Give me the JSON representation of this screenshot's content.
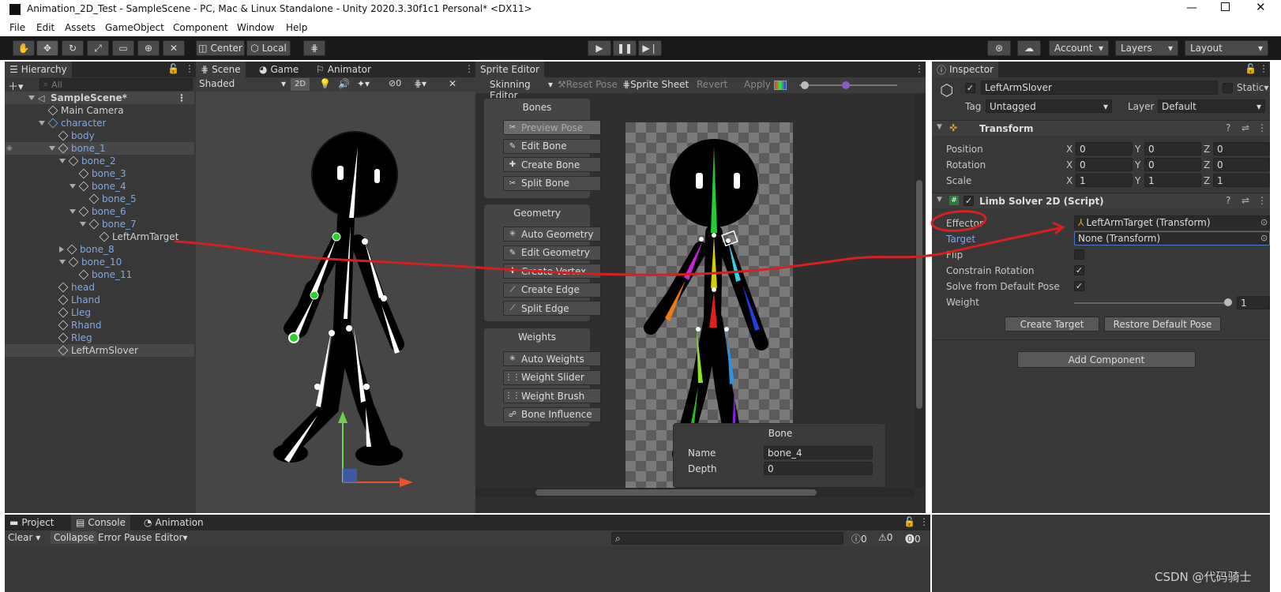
{
  "title_bar": {
    "title": "Animation_2D_Test - SampleScene - PC, Mac & Linux Standalone - Unity 2020.3.30f1c1 Personal* <DX11>"
  },
  "menu": [
    "File",
    "Edit",
    "Assets",
    "GameObject",
    "Component",
    "Window",
    "Help"
  ],
  "toolbar": {
    "center": "Center",
    "local": "Local",
    "account": "Account",
    "layers": "Layers",
    "layout": "Layout"
  },
  "hierarchy": {
    "tab": "Hierarchy",
    "search_placeholder": "All",
    "items": [
      {
        "label": "SampleScene*",
        "blue": false
      },
      {
        "label": "Main Camera",
        "blue": false
      },
      {
        "label": "character",
        "blue": true
      },
      {
        "label": "body",
        "blue": true
      },
      {
        "label": "bone_1",
        "blue": true
      },
      {
        "label": "bone_2",
        "blue": true
      },
      {
        "label": "bone_3",
        "blue": true
      },
      {
        "label": "bone_4",
        "blue": true
      },
      {
        "label": "bone_5",
        "blue": true
      },
      {
        "label": "bone_6",
        "blue": true
      },
      {
        "label": "bone_7",
        "blue": true
      },
      {
        "label": "LeftArmTarget",
        "blue": false
      },
      {
        "label": "bone_8",
        "blue": true
      },
      {
        "label": "bone_10",
        "blue": true
      },
      {
        "label": "bone_11",
        "blue": true
      },
      {
        "label": "head",
        "blue": true
      },
      {
        "label": "Lhand",
        "blue": true
      },
      {
        "label": "Lleg",
        "blue": true
      },
      {
        "label": "Rhand",
        "blue": true
      },
      {
        "label": "Rleg",
        "blue": true
      },
      {
        "label": "LeftArmSlover",
        "blue": false
      }
    ]
  },
  "scene": {
    "tabs": [
      "Scene",
      "Game",
      "Animator"
    ],
    "shading": "Shaded",
    "mode_2d": "2D",
    "hidden_count": "0"
  },
  "sprite_editor": {
    "tab": "Sprite Editor",
    "mode": "Skinning Editor",
    "reset_pose": "Reset Pose",
    "sprite_sheet": "Sprite Sheet",
    "revert": "Revert",
    "apply": "Apply",
    "bones_title": "Bones",
    "bones": [
      "Preview Pose",
      "Edit Bone",
      "Create Bone",
      "Split Bone"
    ],
    "geometry_title": "Geometry",
    "geometry": [
      "Auto Geometry",
      "Edit Geometry",
      "Create Vertex",
      "Create Edge",
      "Split Edge"
    ],
    "weights_title": "Weights",
    "weights": [
      "Auto Weights",
      "Weight Slider",
      "Weight Brush",
      "Bone Influence"
    ],
    "bone_panel": {
      "title": "Bone",
      "name_label": "Name",
      "name_value": "bone_4",
      "depth_label": "Depth",
      "depth_value": "0"
    }
  },
  "inspector": {
    "tab": "Inspector",
    "object_name": "LeftArmSlover",
    "static": "Static",
    "tag_label": "Tag",
    "tag_value": "Untagged",
    "layer_label": "Layer",
    "layer_value": "Default",
    "transform": {
      "title": "Transform",
      "position": "Position",
      "rotation": "Rotation",
      "scale": "Scale",
      "pos": [
        "0",
        "0",
        "0"
      ],
      "rot": [
        "0",
        "0",
        "0"
      ],
      "scl": [
        "1",
        "1",
        "1"
      ]
    },
    "limb": {
      "title": "Limb Solver 2D (Script)",
      "effector": "Effector",
      "effector_value": "LeftArmTarget (Transform)",
      "target": "Target",
      "target_value": "None (Transform)",
      "flip": "Flip",
      "constrain": "Constrain Rotation",
      "solve_default": "Solve from Default Pose",
      "weight": "Weight",
      "weight_value": "1",
      "create_target": "Create Target",
      "restore": "Restore Default Pose"
    },
    "add_component": "Add Component"
  },
  "bottom": {
    "tabs": [
      "Project",
      "Console",
      "Animation"
    ],
    "clear": "Clear",
    "collapse": "Collapse",
    "error_pause": "Error Pause",
    "editor": "Editor",
    "counts": [
      "0",
      "0",
      "0"
    ]
  },
  "watermark": "CSDN @代码骑士"
}
